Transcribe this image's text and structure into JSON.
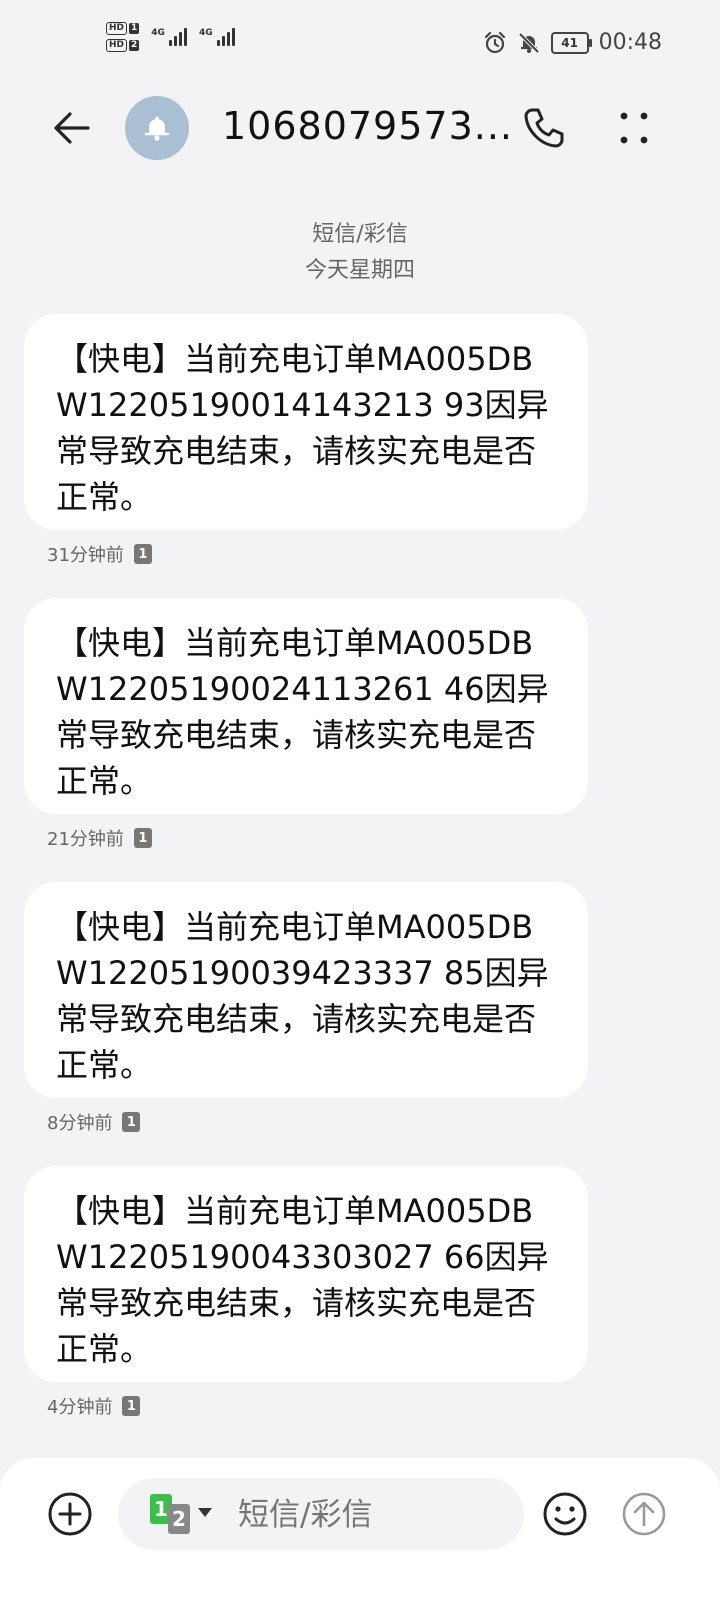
{
  "status_bar": {
    "sim1_badge": "HD",
    "sim1_num": "1",
    "sim2_badge": "HD",
    "sim2_num": "2",
    "network1": "4G",
    "network2": "4G",
    "battery_level": "41",
    "time": "00:48"
  },
  "header": {
    "contact": "1068079573..."
  },
  "divider": {
    "type": "短信/彩信",
    "date": "今天星期四"
  },
  "messages": [
    {
      "text": "【快电】当前充电订单MA005DBW12205190014143213 93因异常导致充电结束，请核实充电是否正常。",
      "time": "31分钟前",
      "sim": "1"
    },
    {
      "text": "【快电】当前充电订单MA005DBW12205190024113261 46因异常导致充电结束，请核实充电是否正常。",
      "time": "21分钟前",
      "sim": "1"
    },
    {
      "text": "【快电】当前充电订单MA005DBW12205190039423337 85因异常导致充电结束，请核实充电是否正常。",
      "time": "8分钟前",
      "sim": "1"
    },
    {
      "text": "【快电】当前充电订单MA005DBW12205190043303027 66因异常导致充电结束，请核实充电是否正常。",
      "time": "4分钟前",
      "sim": "1"
    }
  ],
  "composer": {
    "sim_primary": "1",
    "sim_secondary": "2",
    "placeholder": "短信/彩信"
  },
  "icons": {
    "back": "arrow-left-icon",
    "avatar": "bell-icon",
    "call": "phone-icon",
    "more": "more-vertical-icon",
    "add": "plus-circle-icon",
    "emoji": "smiley-icon",
    "send": "arrow-up-circle-icon"
  }
}
